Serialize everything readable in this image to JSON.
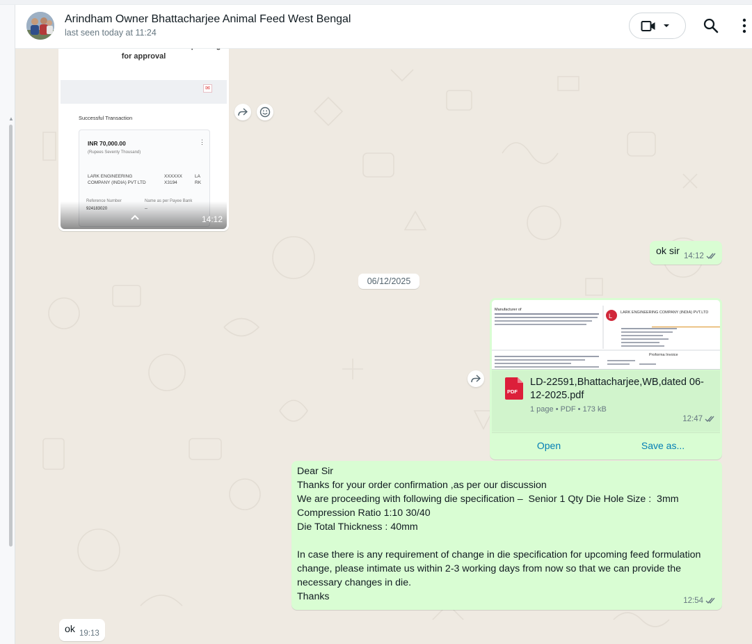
{
  "header": {
    "contact_name": "Arindham Owner Bhattacharjee Animal Feed West Bengal",
    "last_seen": "last seen today at 11:24"
  },
  "icons": {
    "video_call": "video-camera-icon",
    "dropdown": "chevron-down-icon",
    "search": "search-icon",
    "menu": "kebab-menu-icon",
    "forward": "forward-icon",
    "react": "emoji-icon",
    "read_receipt": "double-check-icon",
    "pdf": "pdf-file-icon"
  },
  "colors": {
    "outgoing_bubble": "#d9fdd3",
    "incoming_bubble": "#ffffff",
    "chat_background": "#efeae2",
    "link_blue": "#027eb5",
    "pdf_red": "#dc1f3a"
  },
  "image_message": {
    "time": "14:12",
    "screenshot": {
      "heading": "Fund Transfer is submitted and is pending for approval",
      "section": "Successful Transaction",
      "amount": "INR 70,000.00",
      "amount_words": "(Rupees Seventy Thousand)",
      "payee": "LARK ENGINEERING COMPANY (INDIA) PVT LTD",
      "account": "XXXXXX X3194",
      "bank_short": "LA RK",
      "reference_label": "Reference Number",
      "reference_value": "924183020",
      "payee_bank_label": "Name as per Payee Bank",
      "payee_bank_value": "--"
    }
  },
  "messages": [
    {
      "id": "ok-sir",
      "direction": "out",
      "text": "ok sir",
      "time": "14:12",
      "read": true
    },
    {
      "id": "letter",
      "direction": "out",
      "text": "Dear Sir\nThanks for your order confirmation ,as per our discussion\nWe are proceeding with following die specification –  Senior 1 Qty Die Hole Size :  3mm\nCompression Ratio 1:10 30/40\nDie Total Thickness : 40mm\n\nIn case there is any requirement of change in die specification for upcoming feed formulation change, please intimate us within 2-3 working days from now so that we can provide the necessary changes in die.\nThanks",
      "time": "12:54",
      "read": true
    },
    {
      "id": "ok",
      "direction": "in",
      "text": "ok",
      "time": "19:13"
    }
  ],
  "date_separator": "06/12/2025",
  "document_message": {
    "file_name": "LD-22591,Bhattacharjee,WB,dated 06-12-2025.pdf",
    "file_info": "1 page • PDF • 173 kB",
    "pdf_badge": "PDF",
    "time": "12:47",
    "open_label": "Open",
    "save_label": "Save as...",
    "preview": {
      "manufacturer_label": "Manufacturer of",
      "company": "LARK ENGINEERING COMPANY (INDIA) PVT.LTD",
      "doc_title": "Proforma Invoice"
    }
  }
}
